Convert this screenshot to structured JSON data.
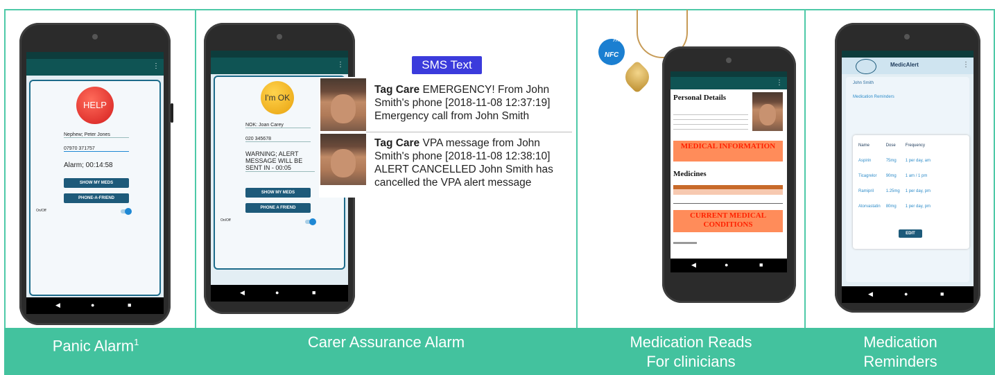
{
  "captions": {
    "panic": "Panic Alarm",
    "panic_sup": "1",
    "carer": "Carer Assurance Alarm",
    "med_reads_1": "Medication Reads",
    "med_reads_2": "For clinicians",
    "med_rem_1": "Medication",
    "med_rem_2": "Reminders"
  },
  "panic": {
    "help_label": "HELP",
    "nok": "Nephew; Peter Jones",
    "phone": "07970 371757",
    "alarm": "Alarm; 00:14:58",
    "btn_meds": "SHOW MY MEDS",
    "btn_friend": "PHONE-A-FRIEND",
    "toggle_label": "On/Off"
  },
  "carer": {
    "ok_label": "I'm OK",
    "nok": "NOK: Joan Carey",
    "phone": "020 345678",
    "warning": "WARNING; ALERT MESSAGE WILL BE SENT IN - 00:05",
    "btn_meds": "SHOW MY MEDS",
    "btn_friend": "PHONE A FRIEND",
    "toggle_label": "On/Off"
  },
  "sms": {
    "badge": "SMS Text",
    "msg1_sender": "Tag Care",
    "msg1_text": " EMERGENCY! From John Smith's phone [2018-11-08 12:37:19] Emergency call from John Smith",
    "msg2_sender": "Tag Care",
    "msg2_text": " VPA message from John Smith's phone [2018-11-08 12:38:10] ALERT CANCELLED John Smith has cancelled the VPA alert message"
  },
  "nfc": {
    "badge": "NFC",
    "personal_details": "Personal Details",
    "medical_info": "MEDICAL INFORMATION",
    "medicines": "Medicines",
    "conditions": "CURRENT MEDICAL CONDITIONS"
  },
  "reminders": {
    "app_title": "MedicAlert",
    "name": "John Smith",
    "link": "Medication Reminders",
    "headers": [
      "Name",
      "Dose",
      "Frequency"
    ],
    "rows": [
      [
        "Aspirin",
        "75mg",
        "1 per day, am"
      ],
      [
        "Ticagrelor",
        "90mg",
        "1 am / 1 pm"
      ],
      [
        "Ramipril",
        "1.25mg",
        "1 per day, pm"
      ],
      [
        "Atorvastatin",
        "80mg",
        "1 per day, pm"
      ]
    ],
    "edit": "EDIT"
  },
  "colors": {
    "accent": "#43c29e",
    "appbar": "#0f5454",
    "help_red": "#e03030",
    "ok_yellow": "#f2b619",
    "sms_blue": "#3b3bdc"
  }
}
